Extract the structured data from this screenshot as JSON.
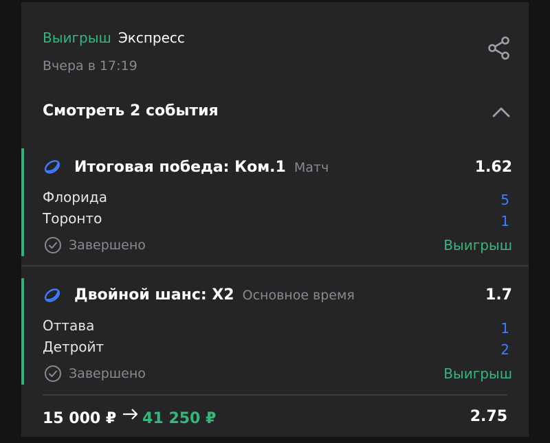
{
  "bet": {
    "status": "Выигрыш",
    "type": "Экспресс",
    "date": "Вчера в 17:19"
  },
  "events_toggle": {
    "label": "Смотреть 2 события"
  },
  "events": [
    {
      "market": "Итоговая победа: Ком.1",
      "period": "Матч",
      "odds": "1.62",
      "team1": "Флорида",
      "team2": "Торонто",
      "score1": "5",
      "score2": "1",
      "state": "Завершено",
      "result": "Выигрыш"
    },
    {
      "market": "Двойной шанс: Х2",
      "period": "Основное время",
      "odds": "1.7",
      "team1": "Оттава",
      "team2": "Детройт",
      "score1": "1",
      "score2": "2",
      "state": "Завершено",
      "result": "Выигрыш"
    }
  ],
  "footer": {
    "stake": "15 000 ₽",
    "payout": "41 250 ₽",
    "total_odds": "2.75"
  },
  "colors": {
    "background": "#141416",
    "card": "#252527",
    "win": "#33b77a",
    "score": "#3d7dff",
    "muted": "#8a8a8e"
  },
  "icons": {
    "share": "share-icon",
    "collapse": "chevron-up-icon",
    "sport": "hockey-puck-icon",
    "completed": "check-circle-icon",
    "arrow": "arrow-right-icon"
  }
}
